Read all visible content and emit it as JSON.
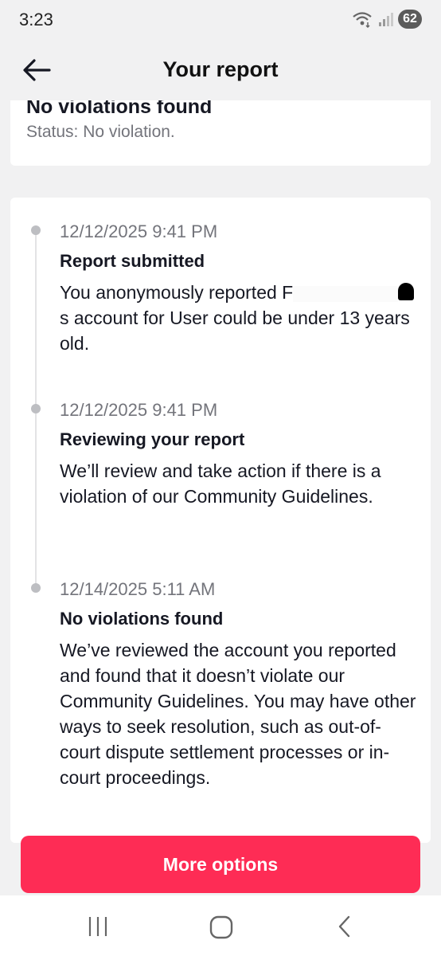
{
  "status_bar": {
    "time": "3:23",
    "battery": "62",
    "icons": [
      "wifi-icon",
      "signal-icon"
    ]
  },
  "header": {
    "title": "Your report",
    "back_icon": "arrow-left-icon"
  },
  "summary": {
    "title": "No violations found",
    "status": "Status: No violation."
  },
  "timeline": [
    {
      "time": "12/12/2025 9:41 PM",
      "title": "Report submitted",
      "description_parts": [
        "You anonymously reported F",
        "s account for User could be under 13 years old."
      ]
    },
    {
      "time": "12/12/2025 9:41 PM",
      "title": "Reviewing your report",
      "description": "We’ll review and take action if there is a violation of our Community Guidelines."
    },
    {
      "time": "12/14/2025 5:11 AM",
      "title": "No violations found",
      "description": "We’ve reviewed the account you reported and found that it doesn’t violate our Community Guidelines. You may have other ways to seek resolution, such as out-of-court dispute settlement processes or in-court proceedings."
    }
  ],
  "actions": {
    "more_options_label": "More options"
  },
  "colors": {
    "accent": "#fe2c55",
    "background": "#f1f1f2",
    "card": "#ffffff",
    "secondary_text": "#73747b"
  },
  "nav_bar": {
    "icons": [
      "recents-icon",
      "home-icon",
      "back-icon"
    ]
  }
}
